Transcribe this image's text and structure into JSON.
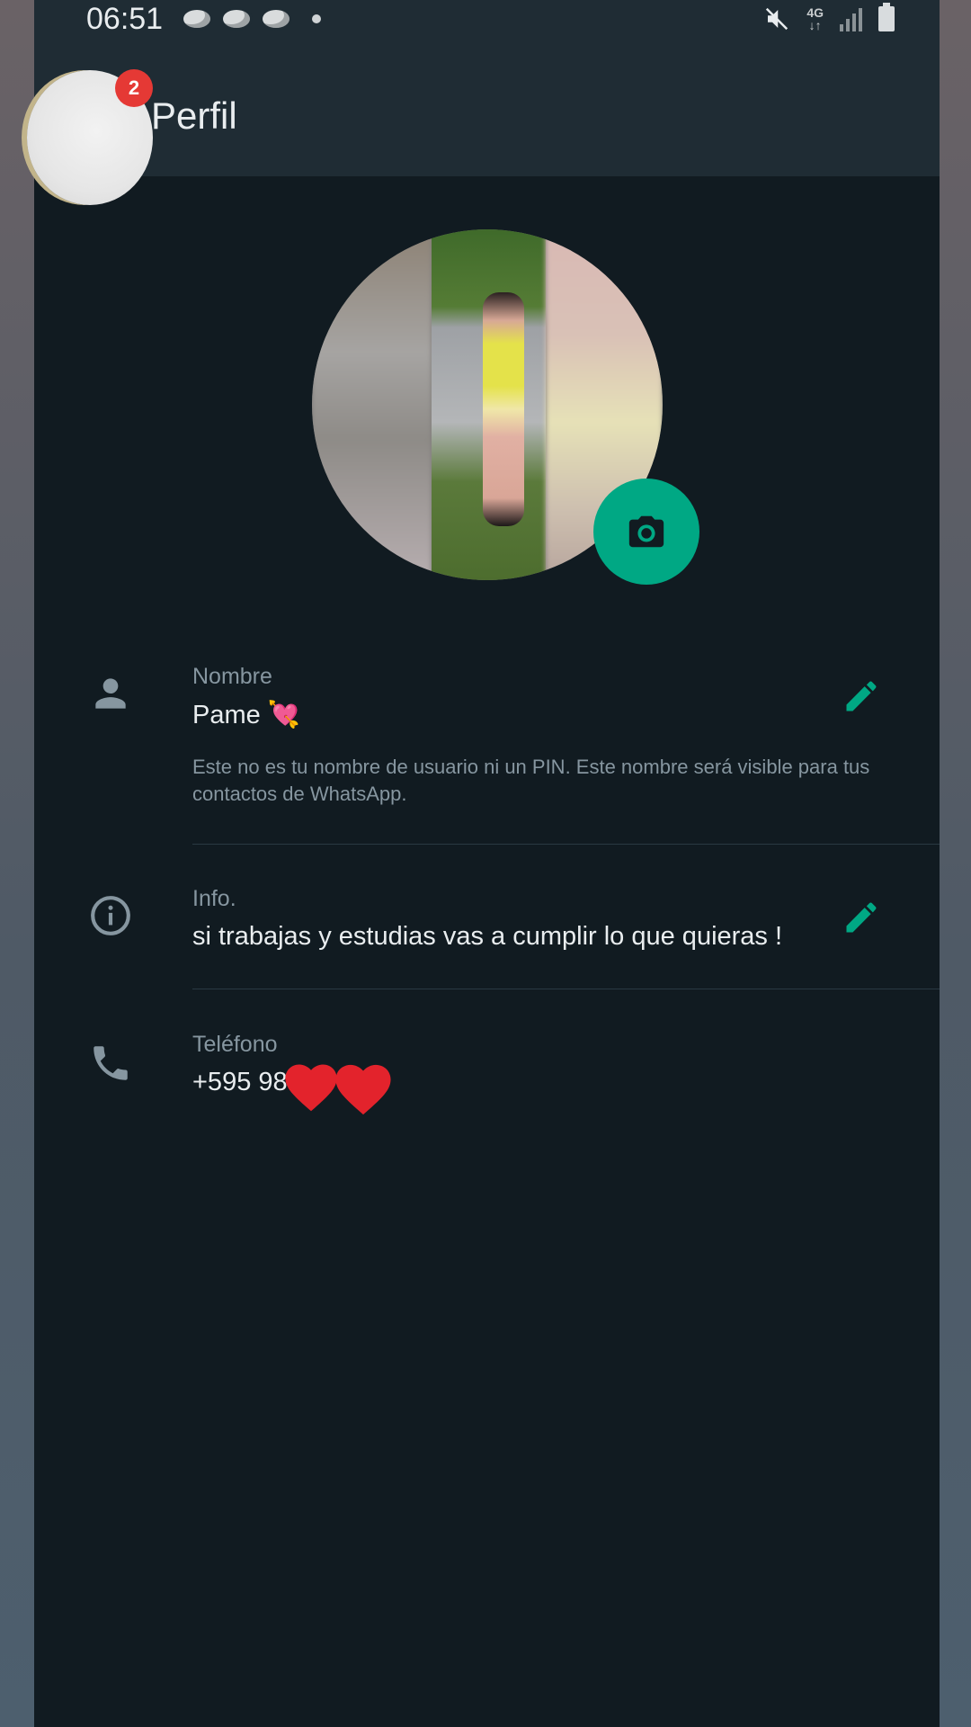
{
  "status_bar": {
    "time": "06:51",
    "network": "4G"
  },
  "app_bar": {
    "title": "Perfil",
    "badge_count": "2"
  },
  "colors": {
    "accent": "#00a884",
    "background": "#111b21",
    "header": "#1f2c34",
    "badge": "#e53935"
  },
  "profile": {
    "name_label": "Nombre",
    "name_value": "Pame 💘",
    "name_hint": "Este no es tu nombre de usuario ni un PIN. Este nombre será visible para tus contactos de WhatsApp.",
    "info_label": "Info.",
    "info_value": "si trabajas y estudias vas a cumplir lo que quieras !",
    "phone_label": "Teléfono",
    "phone_value": "+595 98",
    "phone_decoration": "❤️❤️"
  },
  "icons": {
    "name": "person-icon",
    "info": "info-icon",
    "phone": "phone-icon",
    "edit": "pencil-icon",
    "camera": "camera-icon"
  }
}
